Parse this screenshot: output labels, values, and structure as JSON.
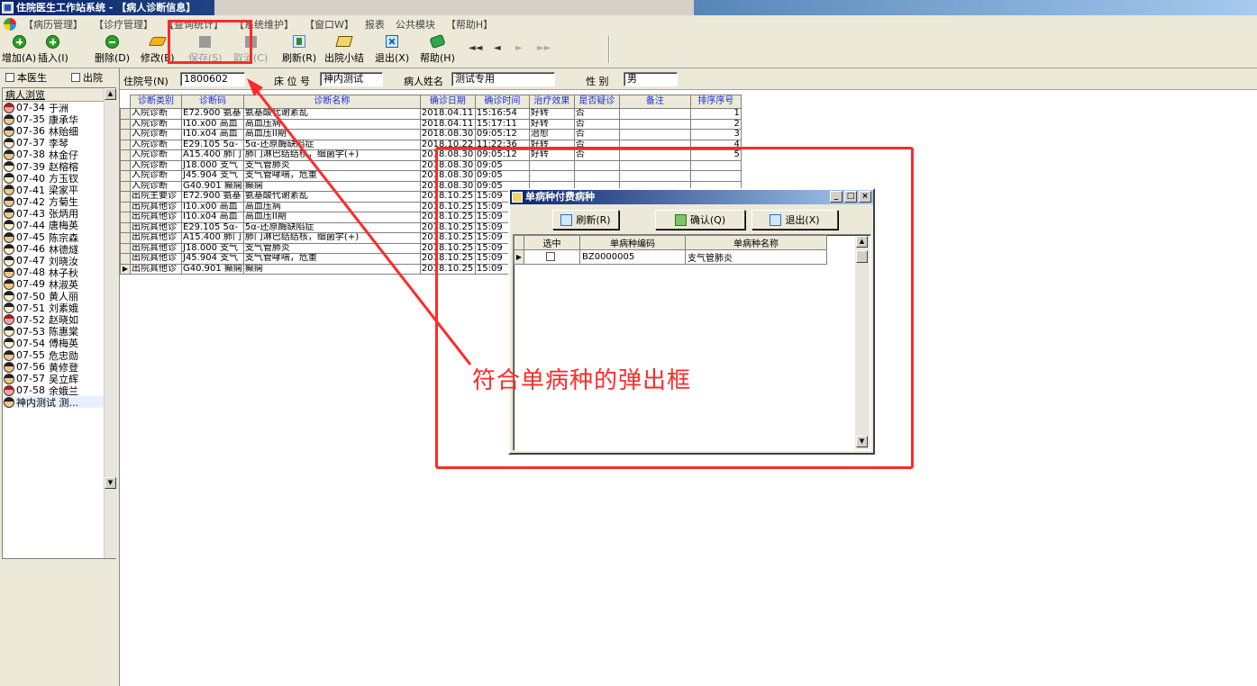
{
  "title": "住院医生工作站系统 - 【病人诊断信息】",
  "menu": [
    "【病历管理】",
    "【诊疗管理】",
    "【查询统计】",
    "【系统维护】",
    "【窗口W】",
    "报表",
    "公共模块",
    "【帮助H】"
  ],
  "toolbar": {
    "add": "增加(A)",
    "insert": "插入(I)",
    "delete": "删除(D)",
    "edit": "修改(E)",
    "save": "保存(S)",
    "cancel": "取消(C)",
    "refresh": "刷新(R)",
    "discharge_summary": "出院小结",
    "exit": "退出(X)",
    "help": "帮助(H)"
  },
  "filters": {
    "my_doctor": "本医生",
    "discharged": "出院"
  },
  "patient_list": {
    "header": "病人浏览",
    "items": [
      {
        "bed": "07-34",
        "name": "于洲",
        "icon": "female"
      },
      {
        "bed": "07-35",
        "name": "康承华",
        "icon": "male"
      },
      {
        "bed": "07-36",
        "name": "林贻细",
        "icon": "male"
      },
      {
        "bed": "07-37",
        "name": "李琴",
        "icon": "child"
      },
      {
        "bed": "07-38",
        "name": "林金仔",
        "icon": "male"
      },
      {
        "bed": "07-39",
        "name": "赵榕榕",
        "icon": "child"
      },
      {
        "bed": "07-40",
        "name": "方玉钗",
        "icon": "child"
      },
      {
        "bed": "07-41",
        "name": "梁家平",
        "icon": "male"
      },
      {
        "bed": "07-42",
        "name": "方菊生",
        "icon": "male"
      },
      {
        "bed": "07-43",
        "name": "张炳用",
        "icon": "male"
      },
      {
        "bed": "07-44",
        "name": "唐梅英",
        "icon": "child"
      },
      {
        "bed": "07-45",
        "name": "陈宗森",
        "icon": "male"
      },
      {
        "bed": "07-46",
        "name": "林德燧",
        "icon": "child"
      },
      {
        "bed": "07-47",
        "name": "刘晓汝",
        "icon": "child"
      },
      {
        "bed": "07-48",
        "name": "林子秋",
        "icon": "male"
      },
      {
        "bed": "07-49",
        "name": "林淑英",
        "icon": "male"
      },
      {
        "bed": "07-50",
        "name": "黄人丽",
        "icon": "child"
      },
      {
        "bed": "07-51",
        "name": "刘素娥",
        "icon": "child"
      },
      {
        "bed": "07-52",
        "name": "赵晓如",
        "icon": "female"
      },
      {
        "bed": "07-53",
        "name": "陈惠棠",
        "icon": "child"
      },
      {
        "bed": "07-54",
        "name": "傅梅英",
        "icon": "child"
      },
      {
        "bed": "07-55",
        "name": "危忠勋",
        "icon": "male"
      },
      {
        "bed": "07-56",
        "name": "黄修登",
        "icon": "male"
      },
      {
        "bed": "07-57",
        "name": "吴立辉",
        "icon": "male"
      },
      {
        "bed": "07-58",
        "name": "余娥兰",
        "icon": "female"
      },
      {
        "bed": "",
        "name": "神内测试 测...",
        "icon": "male"
      }
    ]
  },
  "patient_info": {
    "admission_no_label": "住院号(N)",
    "admission_no": "1800602",
    "bed_label": "床 位 号",
    "bed": "神内测试",
    "name_label": "病人姓名",
    "name": "测试专用",
    "gender_label": "性 别",
    "gender": "男"
  },
  "diagnosis_table": {
    "headers": [
      "诊断类别",
      "诊断码",
      "诊断名称",
      "确诊日期",
      "确诊时间",
      "治疗效果",
      "是否疑诊",
      "备注",
      "排序序号"
    ],
    "rows": [
      [
        "入院诊断",
        "E72.900 氨基",
        "氨基酸代谢紊乱",
        "2018.04.11",
        "15:16:54",
        "好转",
        "否",
        "",
        "1"
      ],
      [
        "入院诊断",
        "I10.x00 高血",
        "高血压病",
        "2018.04.11",
        "15:17:11",
        "好转",
        "否",
        "",
        "2"
      ],
      [
        "入院诊断",
        "I10.x04 高血",
        "高血压II期",
        "2018.08.30",
        "09:05:12",
        "治愈",
        "否",
        "",
        "3"
      ],
      [
        "入院诊断",
        "E29.105 5α-",
        "5α-还原酶缺陷症",
        "2018.10.22",
        "11:22:36",
        "好转",
        "否",
        "",
        "4"
      ],
      [
        "入院诊断",
        "A15.400 肺门",
        "肺门淋巴结结核，细菌学(+)",
        "2018.08.30",
        "09:05:12",
        "好转",
        "否",
        "",
        "5"
      ],
      [
        "入院诊断",
        "J18.000 支气",
        "支气管肺炎",
        "2018.08.30",
        "09:05",
        "",
        "",
        "",
        ""
      ],
      [
        "入院诊断",
        "J45.904 支气",
        "支气管哮喘，危重",
        "2018.08.30",
        "09:05",
        "",
        "",
        "",
        ""
      ],
      [
        "入院诊断",
        "G40.901 癫痫",
        "癫痫",
        "2018.08.30",
        "09:05",
        "",
        "",
        "",
        ""
      ],
      [
        "出院主要诊",
        "E72.900 氨基",
        "氨基酸代谢紊乱",
        "2018.10.25",
        "15:09",
        "",
        "",
        "",
        ""
      ],
      [
        "出院其他诊",
        "I10.x00 高血",
        "高血压病",
        "2018.10.25",
        "15:09",
        "",
        "",
        "",
        ""
      ],
      [
        "出院其他诊",
        "I10.x04 高血",
        "高血压II期",
        "2018.10.25",
        "15:09",
        "",
        "",
        "",
        ""
      ],
      [
        "出院其他诊",
        "E29.105 5α-",
        "5α-还原酶缺陷症",
        "2018.10.25",
        "15:09",
        "",
        "",
        "",
        ""
      ],
      [
        "出院其他诊",
        "A15.400 肺门",
        "肺门淋巴结结核，细菌学(+)",
        "2018.10.25",
        "15:09",
        "",
        "",
        "",
        ""
      ],
      [
        "出院其他诊",
        "J18.000 支气",
        "支气管肺炎",
        "2018.10.25",
        "15:09",
        "",
        "",
        "",
        ""
      ],
      [
        "出院其他诊",
        "J45.904 支气",
        "支气管哮喘，危重",
        "2018.10.25",
        "15:09",
        "",
        "",
        "",
        ""
      ],
      [
        "出院其他诊",
        "G40.901 癫痫",
        "癫痫",
        "2018.10.25",
        "15:09",
        "",
        "",
        "",
        ""
      ]
    ],
    "current_row": 15
  },
  "popup": {
    "title": "单病种付费病种",
    "refresh_label": "刷新(R)",
    "confirm_label": "确认(Q)",
    "exit_label": "退出(X)",
    "headers": [
      "选中",
      "单病种编码",
      "单病种名称"
    ],
    "rows": [
      {
        "checked": false,
        "code": "BZ0000005",
        "name": "支气管肺炎"
      }
    ]
  },
  "annotation": {
    "text": "符合单病种的弹出框",
    "color": "#ff2a2a"
  }
}
